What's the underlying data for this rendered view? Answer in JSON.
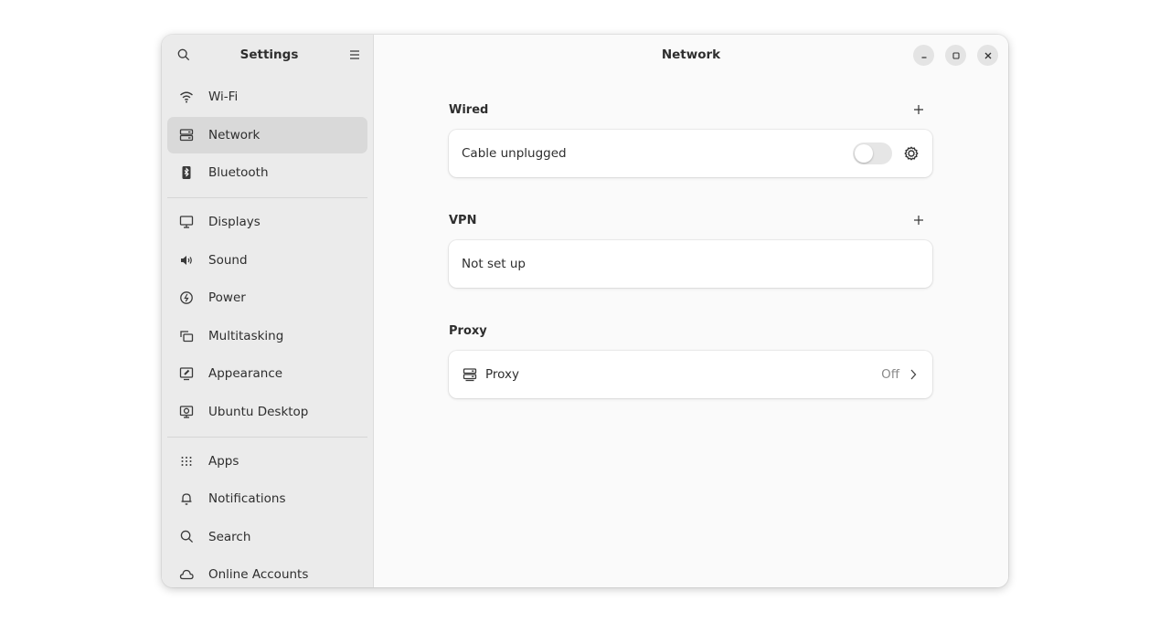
{
  "sidebar": {
    "title": "Settings",
    "items": [
      {
        "label": "Wi-Fi",
        "icon": "wifi-icon"
      },
      {
        "label": "Network",
        "icon": "network-icon",
        "active": true
      },
      {
        "label": "Bluetooth",
        "icon": "bluetooth-icon"
      },
      {
        "label": "Displays",
        "icon": "display-icon"
      },
      {
        "label": "Sound",
        "icon": "speaker-icon"
      },
      {
        "label": "Power",
        "icon": "power-icon"
      },
      {
        "label": "Multitasking",
        "icon": "multitasking-icon"
      },
      {
        "label": "Appearance",
        "icon": "appearance-icon"
      },
      {
        "label": "Ubuntu Desktop",
        "icon": "ubuntu-desktop-icon"
      },
      {
        "label": "Apps",
        "icon": "apps-grid-icon"
      },
      {
        "label": "Notifications",
        "icon": "bell-icon"
      },
      {
        "label": "Search",
        "icon": "search-icon"
      },
      {
        "label": "Online Accounts",
        "icon": "cloud-icon"
      }
    ]
  },
  "header": {
    "title": "Network"
  },
  "sections": {
    "wired": {
      "title": "Wired",
      "row_label": "Cable unplugged",
      "toggle_on": false
    },
    "vpn": {
      "title": "VPN",
      "row_label": "Not set up"
    },
    "proxy": {
      "title": "Proxy",
      "row_label": "Proxy",
      "status": "Off"
    }
  }
}
